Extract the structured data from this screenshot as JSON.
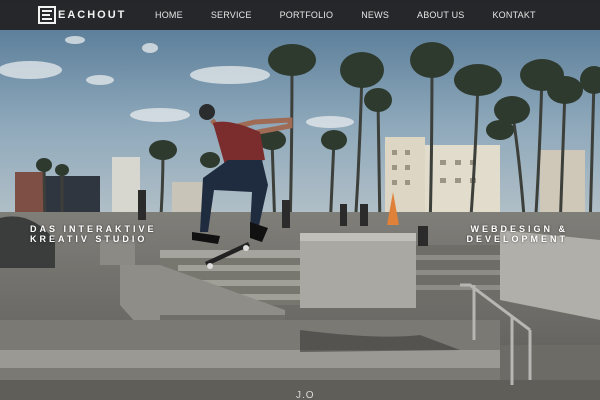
{
  "brand": {
    "name": "EACHOUT",
    "mark_icon": "e-square-logo-icon"
  },
  "nav": {
    "items": [
      {
        "id": "home",
        "label": "HOME"
      },
      {
        "id": "service",
        "label": "SERVICE"
      },
      {
        "id": "portfolio",
        "label": "PORTFOLIO"
      },
      {
        "id": "news",
        "label": "NEWS"
      },
      {
        "id": "about",
        "label": "ABOUT US"
      },
      {
        "id": "kontakt",
        "label": "KONTAKT"
      }
    ]
  },
  "hero": {
    "image": "skatepark-kickflip-photo",
    "tagline_left": {
      "line1": "DAS INTERAKTIVE",
      "line2": "KREATIV STUDIO"
    },
    "tagline_right": {
      "line1": "WEBDESIGN &",
      "line2": "DEVELOPMENT"
    },
    "scroll_hint": "J.O"
  },
  "colors": {
    "navbar": "#232325",
    "nav_text": "#e6e6e6",
    "sky": "#6e8fa8",
    "concrete": "#8c8b86"
  }
}
